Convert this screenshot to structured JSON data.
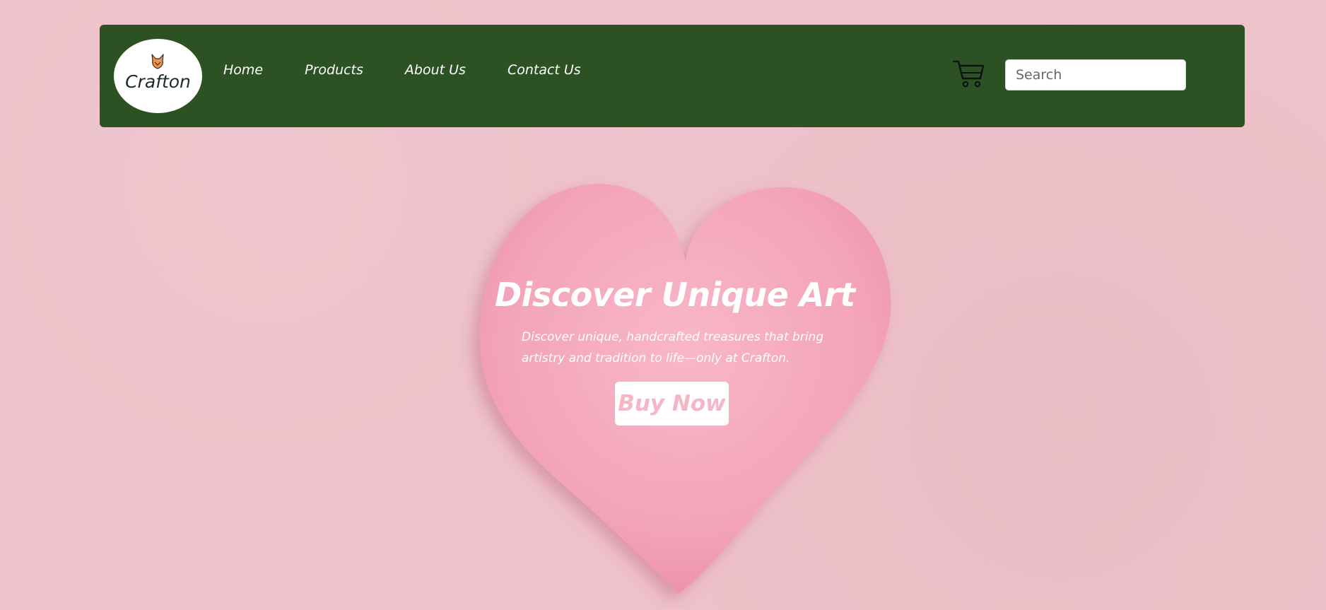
{
  "brand": {
    "name": "Crafton",
    "logo_icon": "fox-icon"
  },
  "nav": {
    "items": [
      {
        "label": "Home"
      },
      {
        "label": "Products"
      },
      {
        "label": "About Us"
      },
      {
        "label": "Contact Us"
      }
    ]
  },
  "header": {
    "cart_icon": "shopping-cart-icon",
    "search": {
      "placeholder": "Search",
      "value": ""
    }
  },
  "hero": {
    "title": "Discover Unique Art",
    "subtitle": "Discover unique, handcrafted treasures that bring artistry and tradition to life—only at Crafton.",
    "cta_label": "Buy Now"
  },
  "colors": {
    "navbar": "#2c5224",
    "page_background": "#eec2ca",
    "heart": "#f4a8bc",
    "cta_text": "#f6b6c7"
  }
}
